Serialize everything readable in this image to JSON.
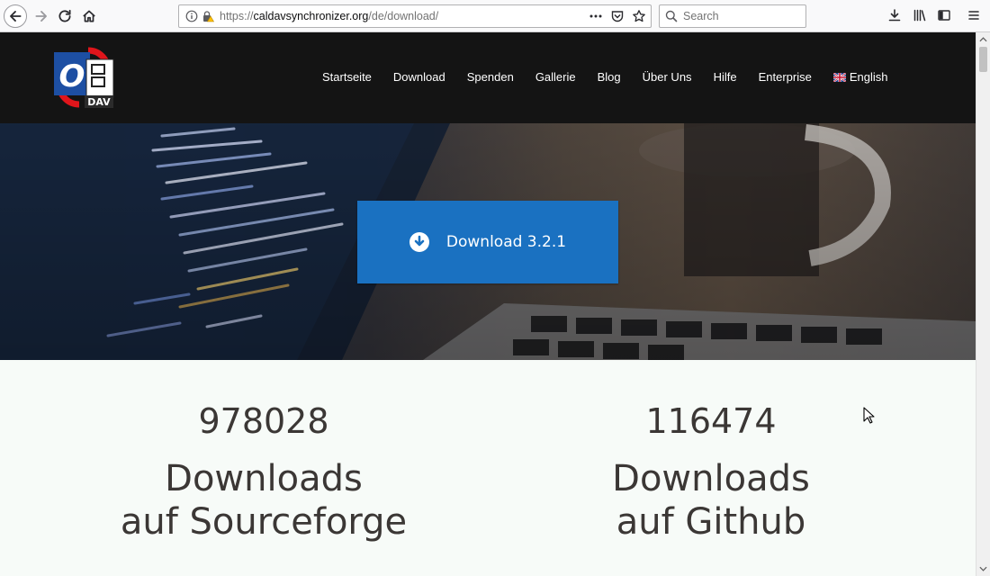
{
  "browser": {
    "url_prefix": "https://",
    "url_host": "caldavsynchronizer.org",
    "url_path": "/de/download/",
    "search_placeholder": "Search"
  },
  "site": {
    "logo": {
      "letter": "O",
      "tag": "DAV"
    },
    "nav": [
      {
        "label": "Startseite"
      },
      {
        "label": "Download"
      },
      {
        "label": "Spenden"
      },
      {
        "label": "Gallerie"
      },
      {
        "label": "Blog"
      },
      {
        "label": "Über Uns"
      },
      {
        "label": "Hilfe"
      },
      {
        "label": "Enterprise"
      },
      {
        "label": "English",
        "icon": "uk-flag-icon"
      }
    ]
  },
  "hero": {
    "download_label": "Download 3.2.1"
  },
  "stats": {
    "sourceforge": {
      "count": "978028",
      "line1": "Downloads",
      "line2": "auf Sourceforge"
    },
    "github": {
      "count": "116474",
      "line1": "Downloads",
      "line2": "auf Github"
    }
  },
  "colors": {
    "header_bg": "#141414",
    "accent_blue": "#1a71c1",
    "stats_text": "#3b3735"
  }
}
